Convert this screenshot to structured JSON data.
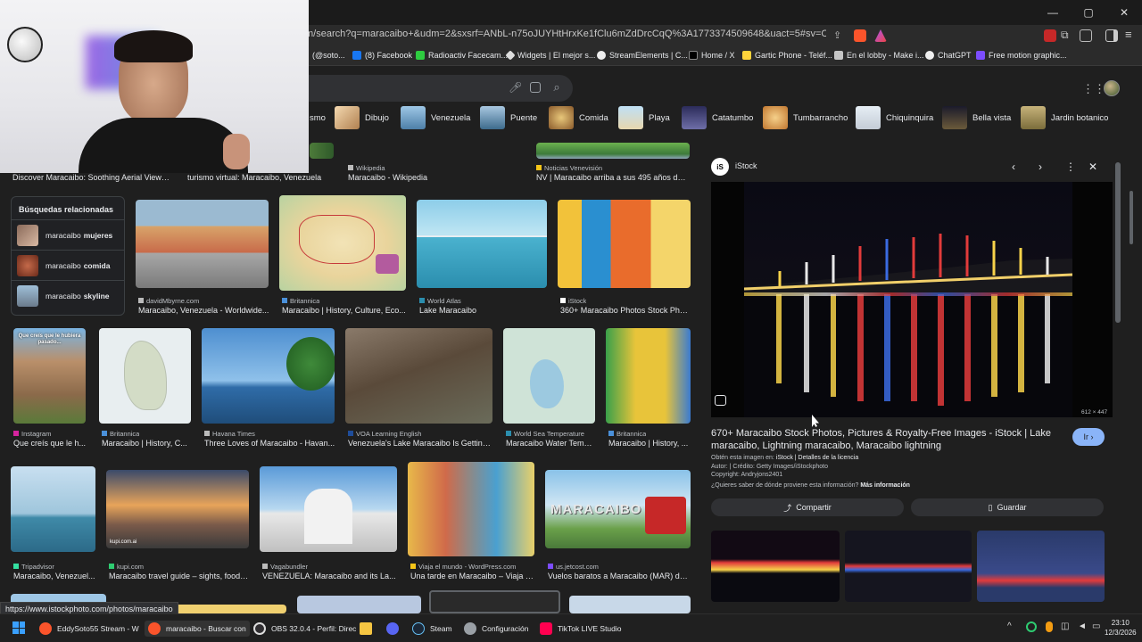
{
  "window": {
    "minimize": "—",
    "maximize": "▢",
    "close": "✕"
  },
  "address_bar": {
    "url": "m/search?q=maracaibo+&udm=2&sxsrf=ANbL-n75oJUYHtHrxKe1fClu6mZdDrcCqQ%3A1773374509648&uact=5#sv=CAMSVhoyKhBlLUI0..."
  },
  "bookmarks": [
    {
      "label": "(@soto..."
    },
    {
      "label": "(8) Facebook"
    },
    {
      "label": "Radioactiv Facecam..."
    },
    {
      "label": "Widgets | El mejor s..."
    },
    {
      "label": "StreamElements | C..."
    },
    {
      "label": "Home / X"
    },
    {
      "label": "Gartic Phone - Teléf..."
    },
    {
      "label": "En el lobby - Make i..."
    },
    {
      "label": "ChatGPT"
    },
    {
      "label": "Free motion graphic..."
    }
  ],
  "chips": [
    "smo",
    "Dibujo",
    "Venezuela",
    "Puente",
    "Comida",
    "Playa",
    "Catatumbo",
    "Tumbarrancho",
    "Chiquinquira",
    "Bella vista",
    "Jardin botanico"
  ],
  "top_row": [
    {
      "source": "",
      "title": "Discover Maracaibo: Soothing Aerial Views I..."
    },
    {
      "source": "",
      "title": "turismo virtual: Maracaibo, Venezuela"
    },
    {
      "source": "Wikipedia",
      "title": "Maracaibo - Wikipedia"
    },
    {
      "source": "Noticias Venevisión",
      "title": "NV | Maracaibo arriba a sus 495 años de f..."
    }
  ],
  "related": {
    "title": "Búsquedas relacionadas",
    "items": [
      {
        "prefix": "maracaibo",
        "bold": "mujeres"
      },
      {
        "prefix": "maracaibo",
        "bold": "comida"
      },
      {
        "prefix": "maracaibo",
        "bold": "skyline"
      }
    ]
  },
  "row1": [
    {
      "source": "davidMbyrne.com",
      "title": "Maracaibo, Venezuela - Worldwide..."
    },
    {
      "source": "Britannica",
      "title": "Maracaibo | History, Culture, Eco..."
    },
    {
      "source": "World Atlas",
      "title": "Lake Maracaibo"
    },
    {
      "source": "iStock",
      "title": "360+ Maracaibo Photos Stock Phot..."
    }
  ],
  "row2": [
    {
      "source": "Instagram",
      "title": "Que creís que le h..."
    },
    {
      "source": "Britannica",
      "title": "Maracaibo | History, C..."
    },
    {
      "source": "Havana Times",
      "title": "Three Loves of Maracaibo - Havan..."
    },
    {
      "source": "VOA Learning English",
      "title": "Venezuela's Lake Maracaibo Is Getting..."
    },
    {
      "source": "World Sea Temperature",
      "title": "Maracaibo Water Temp..."
    },
    {
      "source": "Britannica",
      "title": "Maracaibo | History, ..."
    }
  ],
  "row3": [
    {
      "source": "Tripadvisor",
      "title": "Maracaibo, Venezuel..."
    },
    {
      "source": "kupi.com",
      "title": "Maracaibo travel guide – sights, food ..."
    },
    {
      "source": "Vagabundler",
      "title": "VENEZUELA: Maracaibo and its La..."
    },
    {
      "source": "Viaja el mundo - WordPress.com",
      "title": "Una tarde en Maracaibo – Viaja e..."
    },
    {
      "source": "us.jetcost.com",
      "title": "Vuelos baratos a Maracaibo (MAR) de ..."
    }
  ],
  "image_texts": {
    "instagram_overlay": "Que creís que le hubiera pasado...",
    "kupi_watermark": "kupi.com.ai",
    "maracaibo_sign": "MARACAIBO"
  },
  "panel": {
    "site": "iStock",
    "logo": "iS",
    "size": "612 × 447",
    "title": "670+ Maracaibo Stock Photos, Pictures & Royalty-Free Images - iStock | Lake maracaibo, Lightning maracaibo, Maracaibo lightning",
    "obtain_prefix": "Obtén esta imagen en:",
    "obtain_link": "iStock | Detalles de la licencia",
    "author": "Autor: | Crédito: Getty Images/iStockphoto",
    "copyright": "Copyright: Andryjons2401",
    "question": "¿Quieres saber de dónde proviene esta información?",
    "more_info": "Más información",
    "go_button": "Ir ›",
    "share_button": "Compartir",
    "save_button": "Guardar",
    "nav_prev": "‹",
    "nav_next": "›",
    "menu": "⋮",
    "close": "✕"
  },
  "status_url": "https://www.istockphoto.com/photos/maracaibo",
  "taskbar": {
    "items": [
      {
        "label": "EddySoto55 Stream - W"
      },
      {
        "label": "maracaibo - Buscar con"
      },
      {
        "label": "OBS 32.0.4 - Perfil: Direc"
      },
      {
        "label": ""
      },
      {
        "label": ""
      },
      {
        "label": "Steam"
      },
      {
        "label": "Configuración"
      },
      {
        "label": "TikTok LIVE Studio"
      }
    ],
    "time": "23:10",
    "date": "12/3/2026"
  },
  "colors": {
    "accent": "#8ab4f8",
    "background": "#1f1f1f",
    "chrome": "#2b2b2b"
  }
}
